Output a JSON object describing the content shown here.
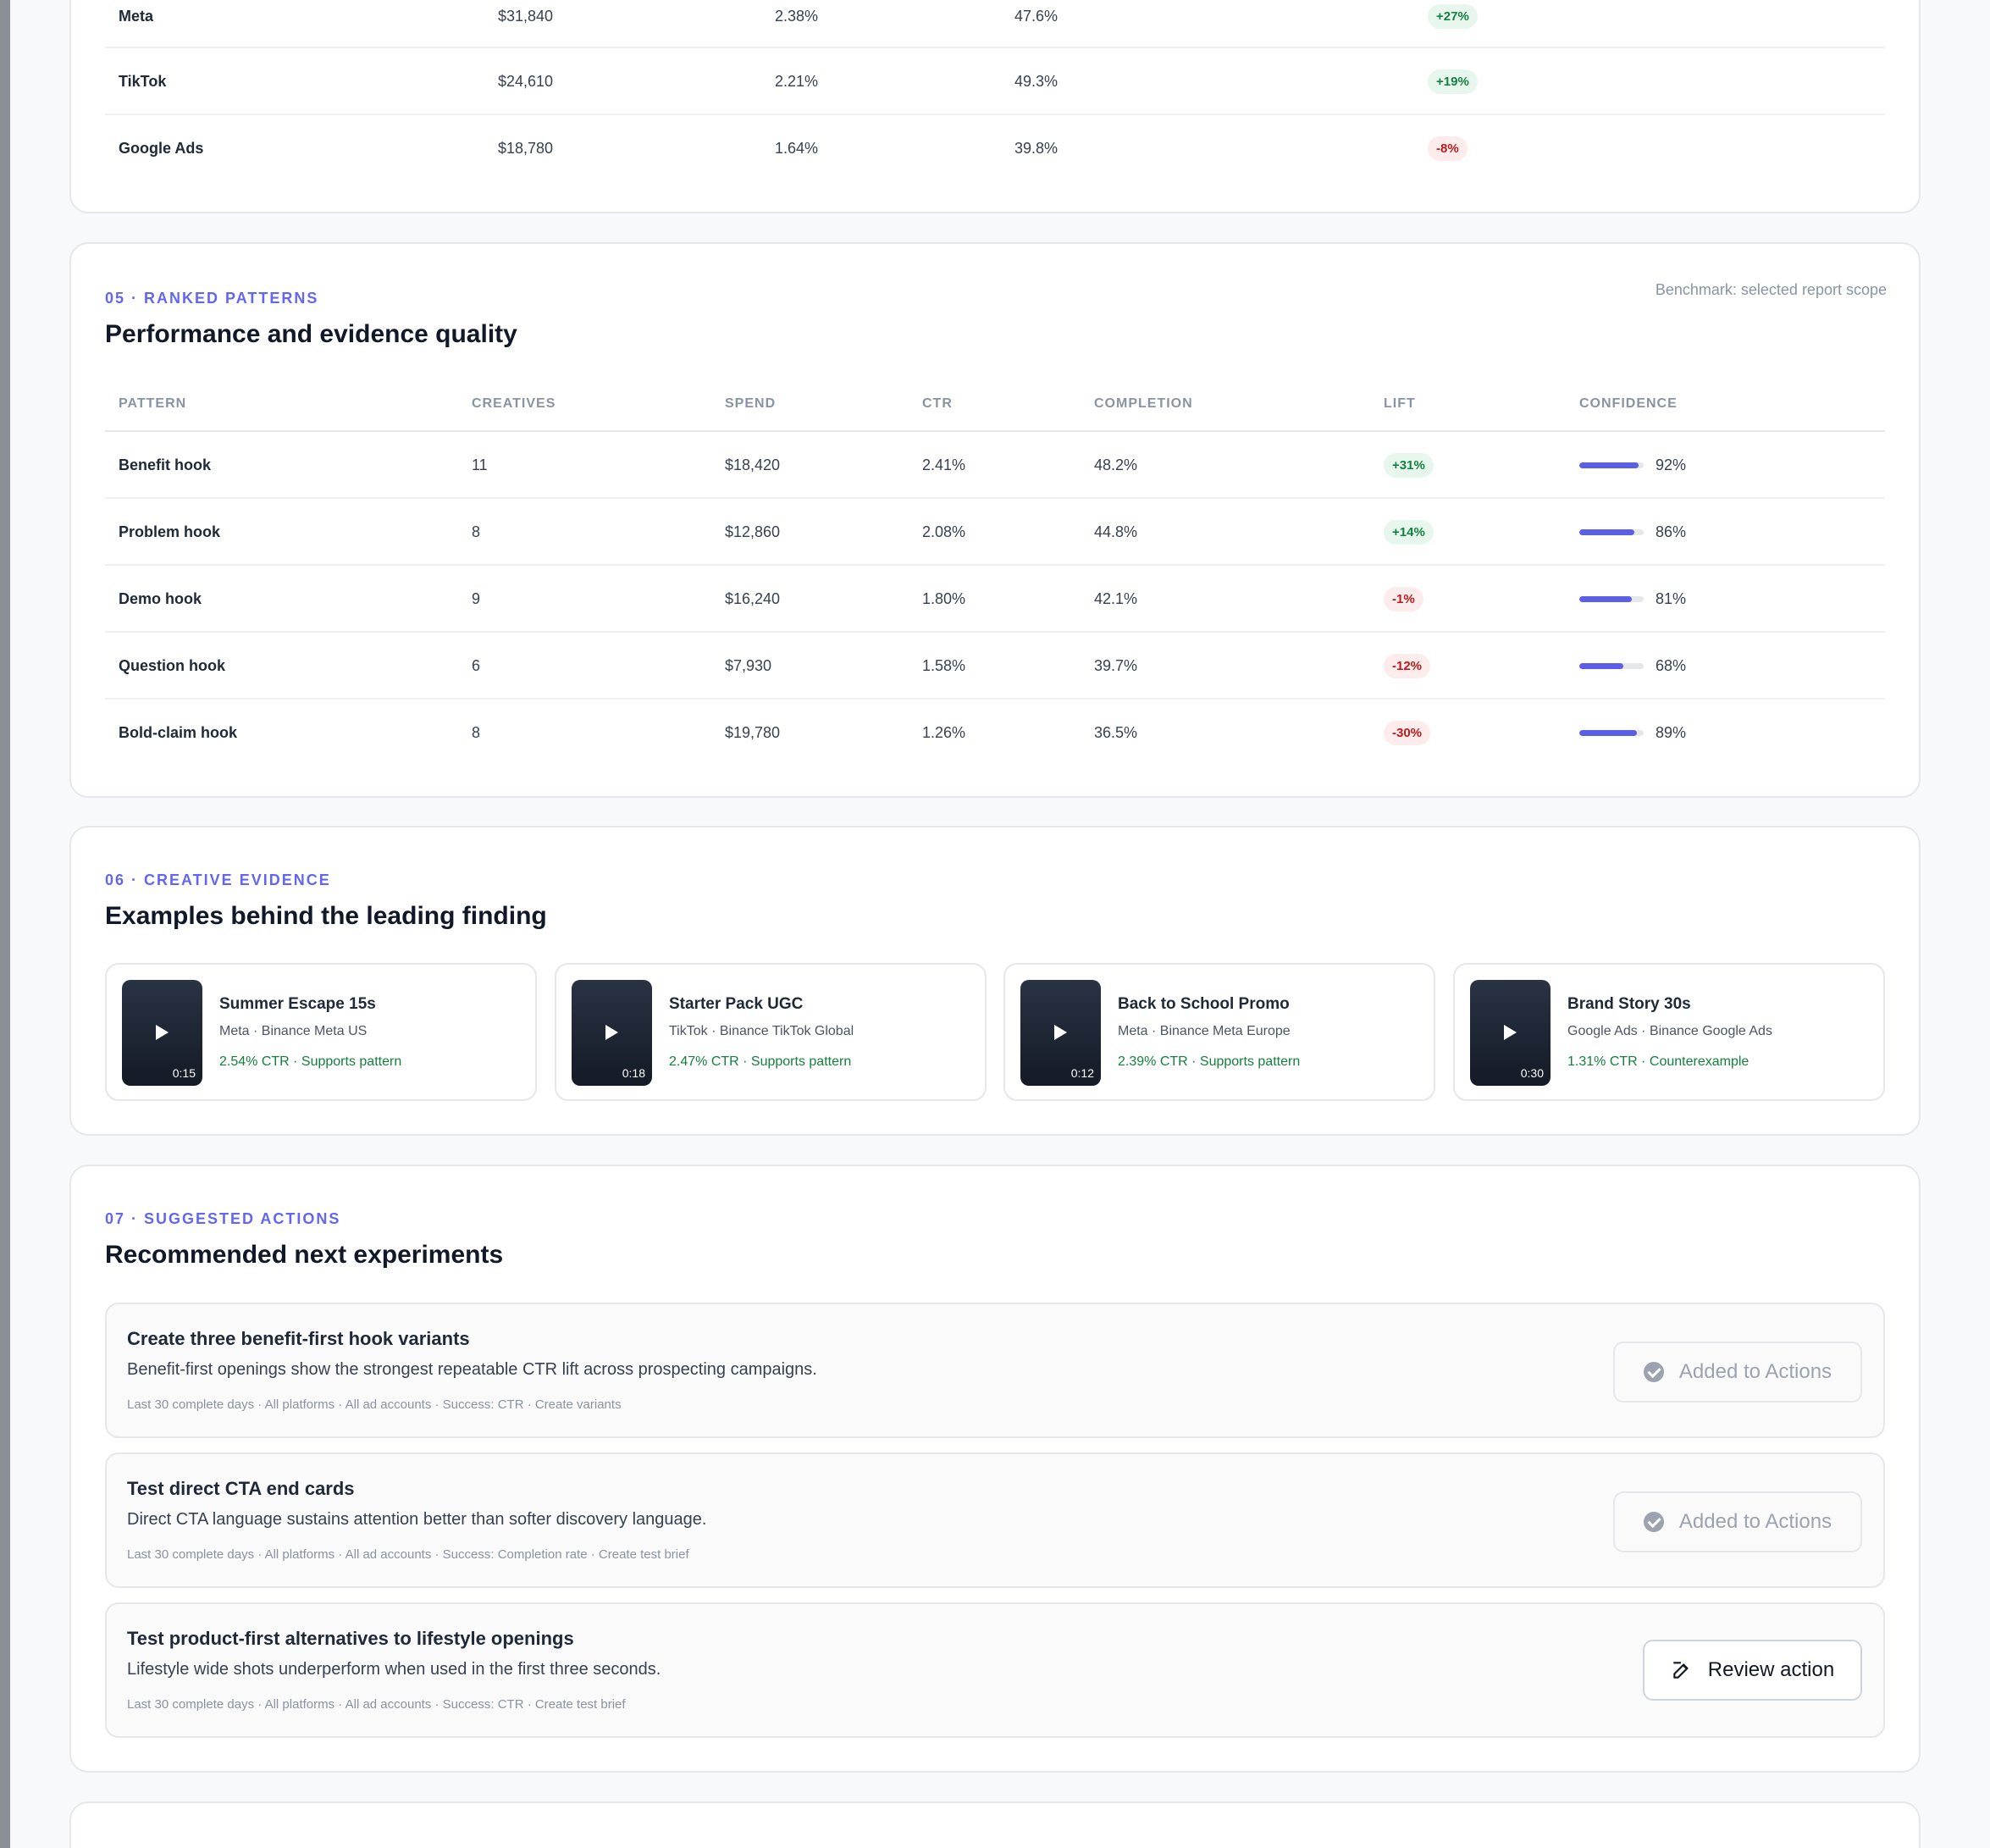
{
  "platform_table": {
    "rows": [
      {
        "name": "Meta",
        "spend": "$31,840",
        "ctr": "2.38%",
        "completion": "47.6%",
        "lift": "+27%",
        "lift_dir": "pos"
      },
      {
        "name": "TikTok",
        "spend": "$24,610",
        "ctr": "2.21%",
        "completion": "49.3%",
        "lift": "+19%",
        "lift_dir": "pos"
      },
      {
        "name": "Google Ads",
        "spend": "$18,780",
        "ctr": "1.64%",
        "completion": "39.8%",
        "lift": "-8%",
        "lift_dir": "neg"
      }
    ]
  },
  "patterns": {
    "eyebrow": "05 · RANKED PATTERNS",
    "title": "Performance and evidence quality",
    "benchmark": "Benchmark: selected report scope",
    "headers": {
      "pattern": "PATTERN",
      "creatives": "CREATIVES",
      "spend": "SPEND",
      "ctr": "CTR",
      "completion": "COMPLETION",
      "lift": "LIFT",
      "confidence": "CONFIDENCE"
    },
    "rows": [
      {
        "name": "Benefit hook",
        "creatives": "11",
        "spend": "$18,420",
        "ctr": "2.41%",
        "completion": "48.2%",
        "lift": "+31%",
        "lift_dir": "pos",
        "confidence": "92%",
        "confidence_value": 0.92
      },
      {
        "name": "Problem hook",
        "creatives": "8",
        "spend": "$12,860",
        "ctr": "2.08%",
        "completion": "44.8%",
        "lift": "+14%",
        "lift_dir": "pos",
        "confidence": "86%",
        "confidence_value": 0.86
      },
      {
        "name": "Demo hook",
        "creatives": "9",
        "spend": "$16,240",
        "ctr": "1.80%",
        "completion": "42.1%",
        "lift": "-1%",
        "lift_dir": "neg",
        "confidence": "81%",
        "confidence_value": 0.81
      },
      {
        "name": "Question hook",
        "creatives": "6",
        "spend": "$7,930",
        "ctr": "1.58%",
        "completion": "39.7%",
        "lift": "-12%",
        "lift_dir": "neg",
        "confidence": "68%",
        "confidence_value": 0.68
      },
      {
        "name": "Bold-claim hook",
        "creatives": "8",
        "spend": "$19,780",
        "ctr": "1.26%",
        "completion": "36.5%",
        "lift": "-30%",
        "lift_dir": "neg",
        "confidence": "89%",
        "confidence_value": 0.89
      }
    ]
  },
  "evidence": {
    "eyebrow": "06 · CREATIVE EVIDENCE",
    "title": "Examples behind the leading finding",
    "items": [
      {
        "title": "Summer Escape 15s",
        "meta": "Meta · Binance Meta US",
        "note": "2.54% CTR · Supports pattern",
        "duration": "0:15"
      },
      {
        "title": "Starter Pack UGC",
        "meta": "TikTok · Binance TikTok Global",
        "note": "2.47% CTR · Supports pattern",
        "duration": "0:18"
      },
      {
        "title": "Back to School Promo",
        "meta": "Meta · Binance Meta Europe",
        "note": "2.39% CTR · Supports pattern",
        "duration": "0:12"
      },
      {
        "title": "Brand Story 30s",
        "meta": "Google Ads · Binance Google Ads",
        "note": "1.31% CTR · Counterexample",
        "duration": "0:30"
      }
    ]
  },
  "actions": {
    "eyebrow": "07 · SUGGESTED ACTIONS",
    "title": "Recommended next experiments",
    "items": [
      {
        "title": "Create three benefit-first hook variants",
        "desc": "Benefit-first openings show the strongest repeatable CTR lift across prospecting campaigns.",
        "meta": "Last 30 complete days · All platforms · All ad accounts · Success: CTR · Create variants",
        "button": "Added to Actions"
      },
      {
        "title": "Test direct CTA end cards",
        "desc": "Direct CTA language sustains attention better than softer discovery language.",
        "meta": "Last 30 complete days · All platforms · All ad accounts · Success: Completion rate · Create test brief",
        "button": "Added to Actions"
      },
      {
        "title": "Test product-first alternatives to lifestyle openings",
        "desc": "Lifestyle wide shots underperform when used in the first three seconds.",
        "meta": "Last 30 complete days · All platforms · All ad accounts · Success: CTR · Create test brief",
        "button": "Review action"
      }
    ]
  },
  "colors": {
    "accent": "#6366f1",
    "positive": "#15803d",
    "negative": "#b91c1c"
  },
  "icons": {
    "play": "play-icon",
    "check": "check-circle-icon",
    "edit": "edit-icon"
  }
}
